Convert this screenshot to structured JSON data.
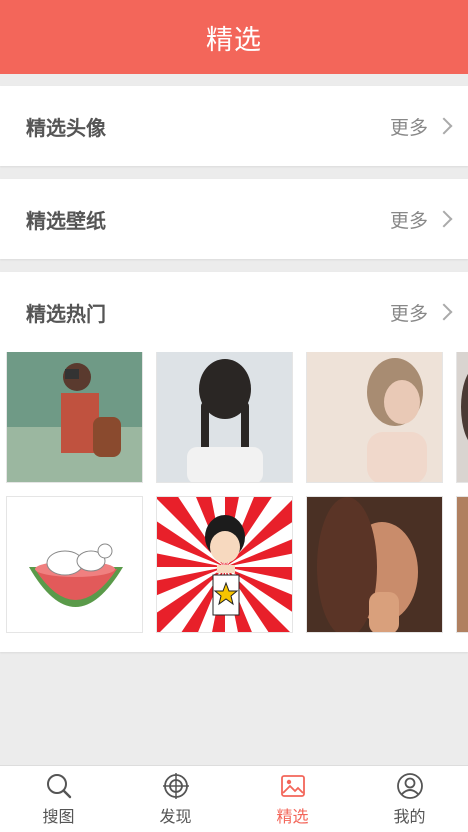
{
  "header": {
    "title": "精选"
  },
  "sections": [
    {
      "title": "精选头像",
      "more": "更多"
    },
    {
      "title": "精选壁纸",
      "more": "更多"
    },
    {
      "title": "精选热门",
      "more": "更多"
    }
  ],
  "tabs": [
    {
      "label": "搜图",
      "icon": "search-icon"
    },
    {
      "label": "发现",
      "icon": "target-icon"
    },
    {
      "label": "精选",
      "icon": "image-icon",
      "active": true
    },
    {
      "label": "我的",
      "icon": "user-icon"
    }
  ],
  "colors": {
    "accent": "#f3665a",
    "background": "#ececec"
  }
}
